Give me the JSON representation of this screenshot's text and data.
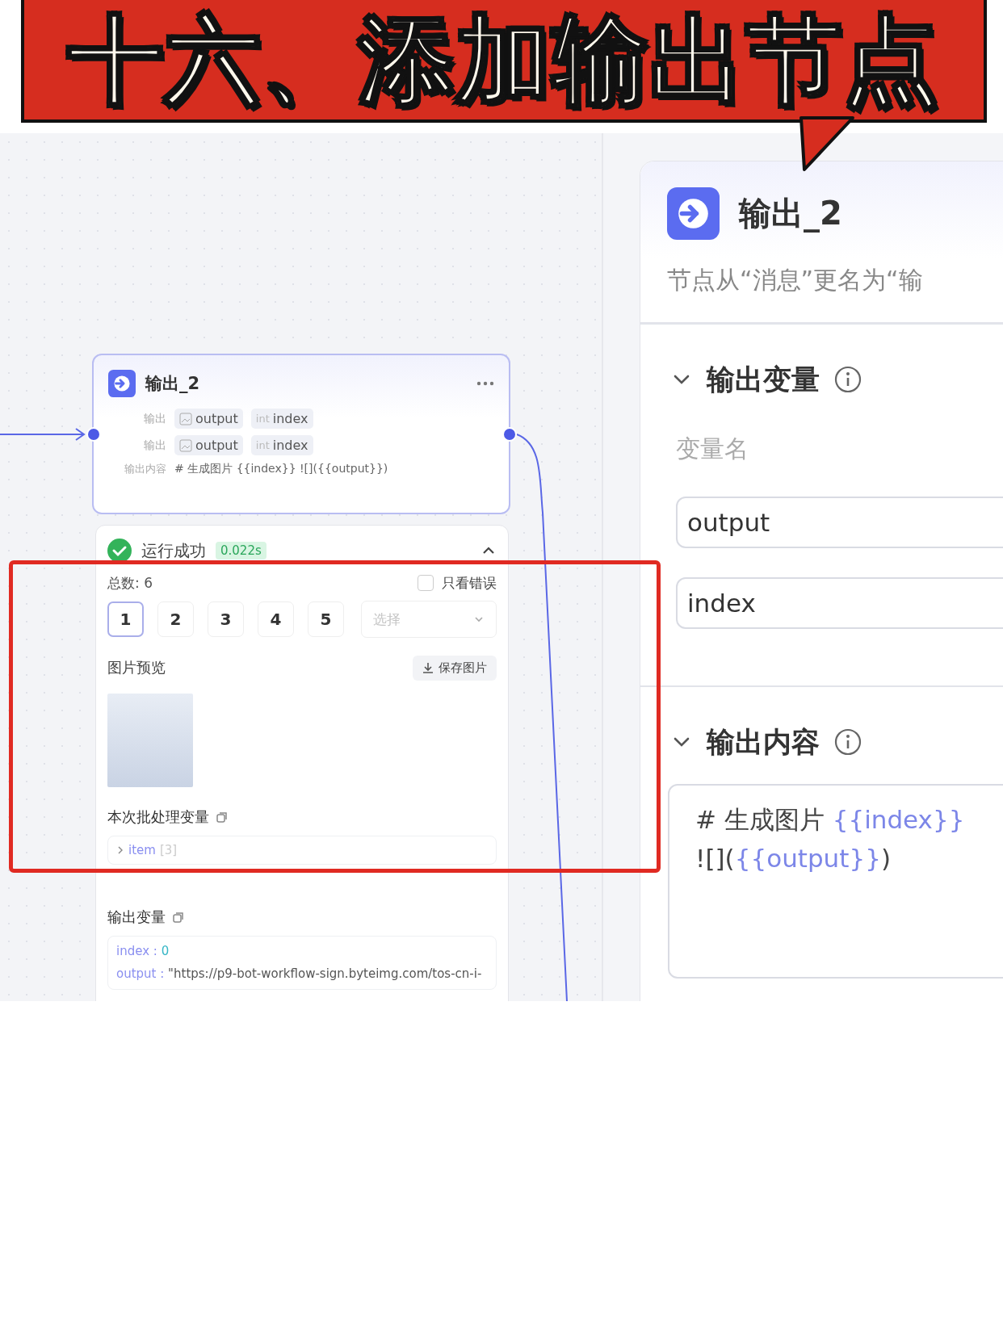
{
  "banner": {
    "title": "十六、添加输出节点"
  },
  "canvas": {
    "node": {
      "title": "输出_2",
      "rows": [
        {
          "label": "输出",
          "tags": [
            {
              "kind": "image",
              "name": "output"
            },
            {
              "kind": "int",
              "prefix": "int",
              "name": "index"
            }
          ]
        },
        {
          "label": "输出",
          "tags": [
            {
              "kind": "image",
              "name": "output"
            },
            {
              "kind": "int",
              "prefix": "int",
              "name": "index"
            }
          ]
        }
      ],
      "content_label": "输出内容",
      "content": "# 生成图片 {{index}} ![]({{output}})"
    },
    "result": {
      "status": "运行成功",
      "time": "0.022s",
      "expanded": true,
      "total": "总数: 6",
      "error_filter": {
        "label": "只看错误",
        "checked": false
      },
      "pages": [
        {
          "label": "1",
          "selected": true
        },
        {
          "label": "2",
          "selected": false
        },
        {
          "label": "3",
          "selected": false
        },
        {
          "label": "4",
          "selected": false
        },
        {
          "label": "5",
          "selected": false
        }
      ],
      "select": {
        "placeholder": "选择"
      },
      "preview_label": "图片预览",
      "save_button": "保存图片",
      "batch_label": "本次批处理变量",
      "batch_item": {
        "name": "item",
        "count": "[3]",
        "expanded": false
      },
      "output_label": "输出变量",
      "outputs": [
        {
          "key": "index",
          "separator": ":",
          "value": "0",
          "kind": "number"
        },
        {
          "key": "output",
          "separator": ":",
          "value": "\"https://p9-bot-workflow-sign.byteimg.com/tos-cn-i-",
          "kind": "string"
        }
      ]
    }
  },
  "panel": {
    "title": "输出_2",
    "subtitle": "节点从“消息”更名为“输",
    "sections": [
      {
        "kind": "fields",
        "title": "输出变量",
        "expanded": true,
        "field_label": "变量名",
        "fields": [
          "output",
          "index"
        ]
      },
      {
        "kind": "content",
        "title": "输出内容",
        "expanded": true,
        "lines": [
          [
            {
              "kind": "plain",
              "text": "# 生成图片 "
            },
            {
              "kind": "variable",
              "text": "{{index}}"
            }
          ],
          [
            {
              "kind": "plain",
              "text": "![]("
            },
            {
              "kind": "variable",
              "text": "{{output}}"
            },
            {
              "kind": "plain",
              "text": ")"
            }
          ]
        ]
      }
    ]
  }
}
